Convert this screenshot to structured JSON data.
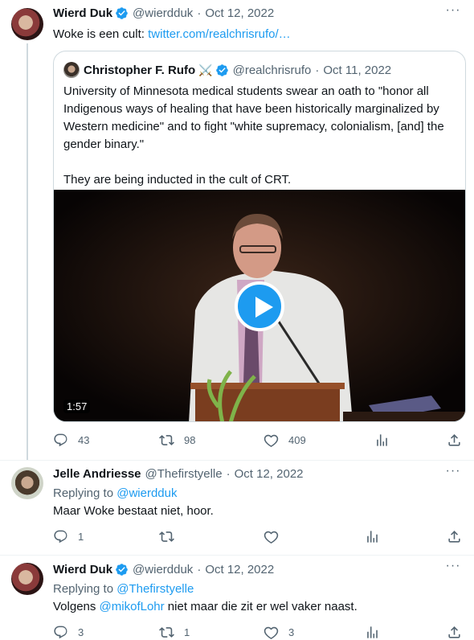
{
  "tweet1": {
    "name": "Wierd Duk",
    "handle": "@wierdduk",
    "sep": "·",
    "date": "Oct 12, 2022",
    "text": "Woke is een cult: ",
    "link": "twitter.com/realchrisrufo/…",
    "quote": {
      "name": "Christopher F. Rufo",
      "badge": "⚔️",
      "handle": "@realchrisrufo",
      "sep": "·",
      "date": "Oct 11, 2022",
      "text": "University of Minnesota medical students swear an oath to \"honor all Indigenous ways of healing that have been historically marginalized by Western medicine\" and to fight \"white supremacy, colonialism, [and] the gender binary.\"\n\nThey are being inducted in the cult of CRT.",
      "video_duration": "1:57"
    },
    "replies": "43",
    "retweets": "98",
    "likes": "409"
  },
  "tweet2": {
    "name": "Jelle Andriesse",
    "handle": "@Thefirstyelle",
    "sep": "·",
    "date": "Oct 12, 2022",
    "replying_prefix": "Replying to ",
    "replying_to": "@wierdduk",
    "text": "Maar Woke bestaat niet, hoor.",
    "replies": "1"
  },
  "tweet3": {
    "name": "Wierd Duk",
    "handle": "@wierdduk",
    "sep": "·",
    "date": "Oct 12, 2022",
    "replying_prefix": "Replying to ",
    "replying_to": "@Thefirstyelle",
    "text_pre": "Volgens ",
    "mention": "@mikofLohr",
    "text_post": " niet maar die zit er wel vaker naast.",
    "replies": "3",
    "retweets": "1",
    "likes": "3"
  },
  "more_label": "···",
  "colors": {
    "accent": "#1d9bf0",
    "muted": "#536471",
    "border": "#cfd9de"
  }
}
